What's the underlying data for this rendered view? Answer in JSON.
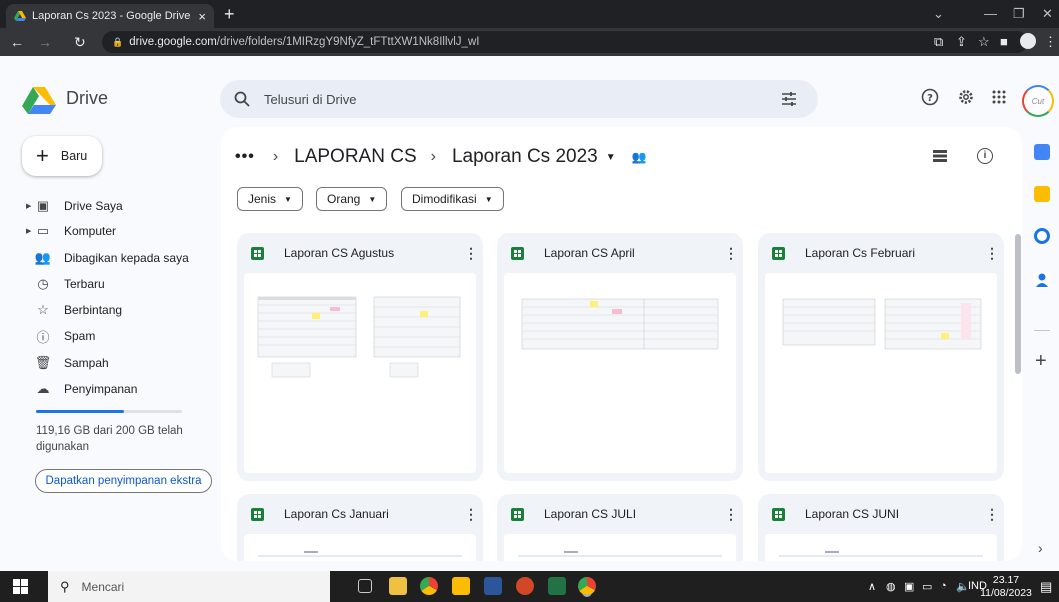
{
  "browser": {
    "tab_title": "Laporan Cs 2023 - Google Drive",
    "tab_close": "×",
    "new_tab": "+",
    "url_host": "drive.google.com",
    "url_path": "/drive/folders/1MIRzgY9NfyZ_tFTttXW1Nk8IllvlJ_wI"
  },
  "drive": {
    "app_name": "Drive",
    "search_placeholder": "Telusuri di Drive"
  },
  "sidebar": {
    "new_label": "Baru",
    "items": [
      {
        "label": "Drive Saya",
        "icon": "my-drive-icon"
      },
      {
        "label": "Komputer",
        "icon": "computer-icon"
      },
      {
        "label": "Dibagikan kepada saya",
        "icon": "shared-icon"
      },
      {
        "label": "Terbaru",
        "icon": "clock-icon"
      },
      {
        "label": "Berbintang",
        "icon": "star-icon"
      },
      {
        "label": "Spam",
        "icon": "spam-icon"
      },
      {
        "label": "Sampah",
        "icon": "trash-icon"
      },
      {
        "label": "Penyimpanan",
        "icon": "cloud-icon"
      }
    ],
    "storage_fraction": 0.6,
    "storage_text": "119,16 GB dari 200 GB telah digunakan",
    "storage_button": "Dapatkan penyimpanan ekstra"
  },
  "breadcrumb": {
    "dots": "•••",
    "parent": "LAPORAN CS",
    "current": "Laporan Cs 2023"
  },
  "filters": [
    "Jenis",
    "Orang",
    "Dimodifikasi"
  ],
  "files": [
    {
      "title": "Laporan CS Agustus"
    },
    {
      "title": "Laporan CS April"
    },
    {
      "title": "Laporan Cs Februari"
    },
    {
      "title": "Laporan Cs Januari"
    },
    {
      "title": "Laporan CS JULI"
    },
    {
      "title": "Laporan CS JUNI"
    }
  ],
  "taskbar": {
    "search_placeholder": "Mencari",
    "lang": "IND",
    "time": "23.17",
    "date": "11/08/2023"
  },
  "colors": {
    "accent": "#1a73e8",
    "sheets_green": "#188038"
  }
}
